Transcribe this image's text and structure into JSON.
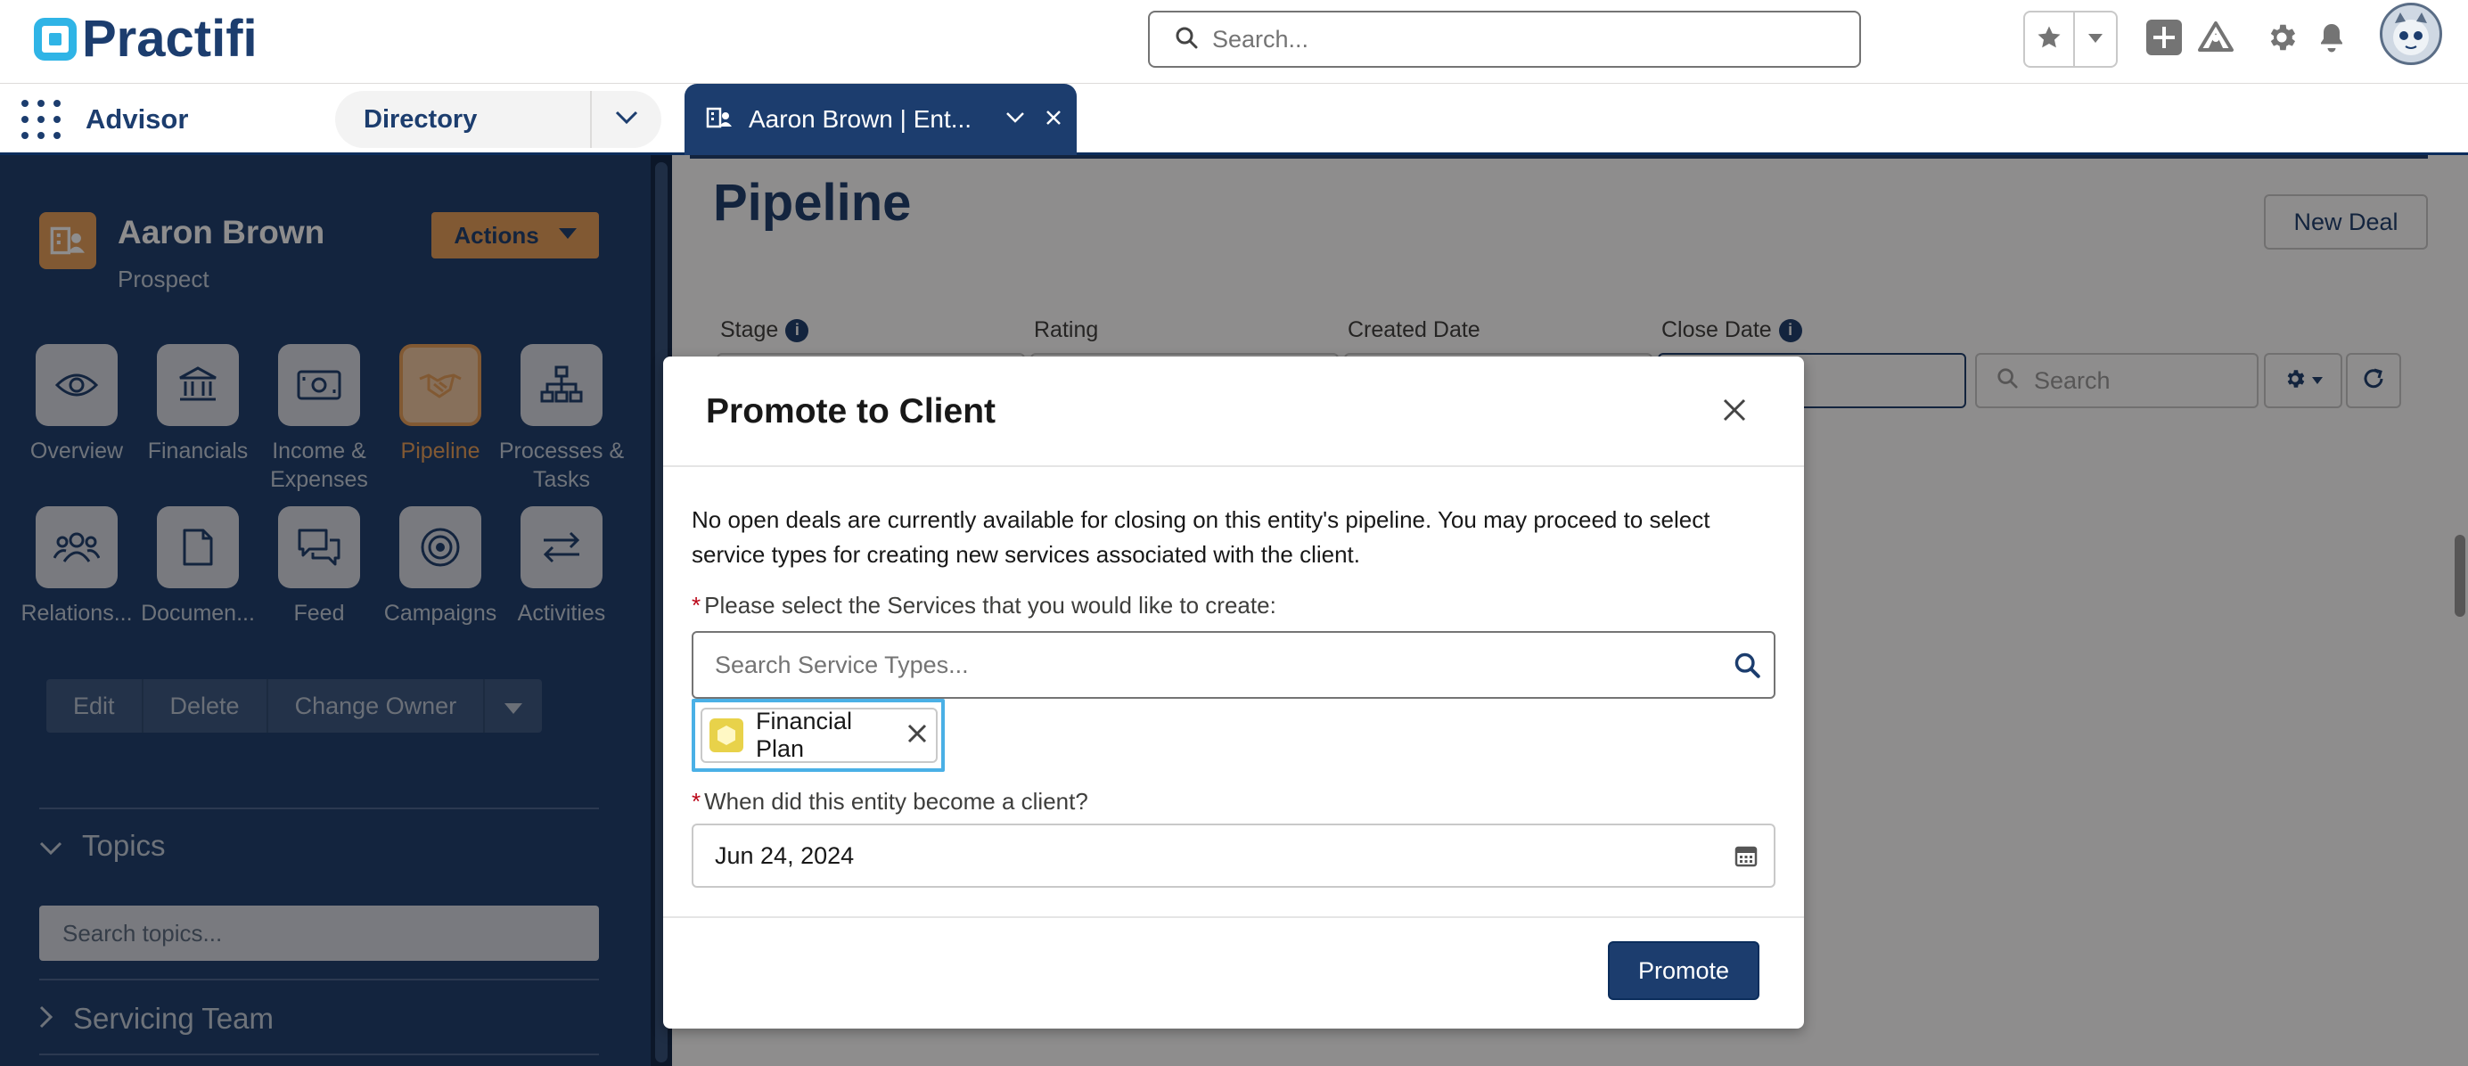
{
  "header": {
    "logo_text": "Practifi",
    "search_placeholder": "Search...",
    "icons": [
      "star-icon",
      "chevron-down-icon",
      "add-icon",
      "trailhead-icon",
      "gear-icon",
      "bell-icon",
      "avatar"
    ]
  },
  "nav": {
    "app_name": "Advisor",
    "directory_label": "Directory",
    "tab_label": "Aaron Brown | Ent..."
  },
  "sidebar": {
    "entity_name": "Aaron Brown",
    "entity_type": "Prospect",
    "actions_label": "Actions",
    "tiles": [
      {
        "label": "Overview",
        "icon": "eye-icon"
      },
      {
        "label": "Financials",
        "icon": "bank-icon"
      },
      {
        "label": "Income & Expenses",
        "icon": "money-icon"
      },
      {
        "label": "Pipeline",
        "icon": "handshake-icon",
        "active": true
      },
      {
        "label": "Processes & Tasks",
        "icon": "hierarchy-icon"
      },
      {
        "label": "Relations...",
        "icon": "people-icon"
      },
      {
        "label": "Documen...",
        "icon": "document-icon"
      },
      {
        "label": "Feed",
        "icon": "chat-icon"
      },
      {
        "label": "Campaigns",
        "icon": "target-icon"
      },
      {
        "label": "Activities",
        "icon": "swap-icon"
      }
    ],
    "buttons": [
      "Edit",
      "Delete",
      "Change Owner"
    ],
    "topics_label": "Topics",
    "topics_placeholder": "Search topics...",
    "servicing_team_label": "Servicing Team"
  },
  "main": {
    "page_title": "Pipeline",
    "new_deal_label": "New Deal",
    "filters": {
      "stage_label": "Stage",
      "rating_label": "Rating",
      "created_date_label": "Created Date",
      "close_date_label": "Close Date",
      "search_placeholder": "Search",
      "info_glyph": "i"
    }
  },
  "modal": {
    "title": "Promote to Client",
    "message": "No open deals are currently available for closing on this entity's pipeline. You may proceed to select service types for creating new services associated with the client.",
    "required_mark": "*",
    "services_label": "Please select the Services that you would like to create:",
    "services_placeholder": "Search Service Types...",
    "selected_service": "Financial Plan",
    "client_date_label": "When did this entity become a client?",
    "client_date_value": "Jun 24, 2024",
    "promote_label": "Promote"
  },
  "colors": {
    "brand_navy": "#1c3d6e",
    "accent_orange": "#e89f5a",
    "logo_blue": "#2fb4e6",
    "focus_blue": "#4ab0e6",
    "required_red": "#ba0517",
    "service_pill_yellow": "#e8d24a"
  }
}
